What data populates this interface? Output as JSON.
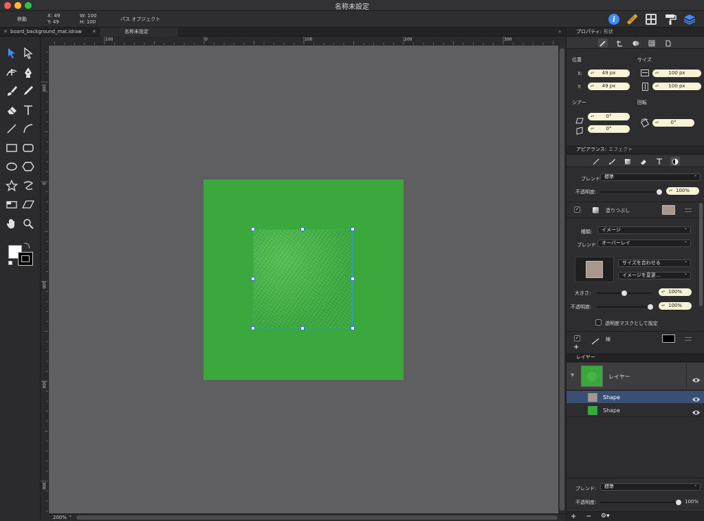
{
  "window": {
    "title": "名称未設定"
  },
  "toolbar": {
    "move_label": "移動",
    "x": "X:  49",
    "y": "Y:  49",
    "w": "W:  100",
    "h": "H:  100",
    "object_type": "パス オブジェクト"
  },
  "tabs": [
    {
      "label": "board_background_mat.idraw"
    },
    {
      "label": "名称未設定"
    }
  ],
  "ruler": {
    "top": [
      "100",
      "0",
      "100",
      "200",
      "300"
    ],
    "left": [
      "100",
      "0",
      "100",
      "200",
      "300"
    ]
  },
  "status": {
    "zoom": "200%"
  },
  "properties": {
    "header": "プロパティ:",
    "header_sub": "形状",
    "position_label": "位置",
    "size_label": "サイズ",
    "x_label": "X:",
    "y_label": "Y:",
    "x_value": "49 px",
    "y_value": "49 px",
    "w_value": "100 px",
    "h_value": "100 px",
    "shear_label": "シアー",
    "rotate_label": "回転",
    "shear_h": "0°",
    "shear_v": "0°",
    "rotate_value": "0°"
  },
  "appearance": {
    "header": "アピアランス:",
    "header_sub": "エフェクト",
    "blend_label": "ブレンド",
    "blend_value": "標準",
    "opacity_label": "不透明度:",
    "opacity_value": "100%",
    "opacity_level": 1.0,
    "fill_label": "塗りつぶし",
    "kind_label": "種類:",
    "kind_value": "イメージ",
    "fill_blend_label": "ブレンド",
    "fill_blend_value": "オーバーレイ",
    "fit_size": "サイズを合わせる",
    "change_image": "イメージを変更...",
    "scale_label": "大きさ:",
    "scale_value": "100%",
    "fill_opacity_label": "不透明度:",
    "fill_opacity_value": "100%",
    "mask_label": "透明度マスクとして設定",
    "stroke_label": "線",
    "add": "+"
  },
  "layers": {
    "header": "レイヤー",
    "layer_name": "レイヤー",
    "items": [
      {
        "label": "Shape",
        "selected": true
      },
      {
        "label": "Shape",
        "selected": false
      }
    ],
    "blend_label": "ブレンド:",
    "blend_value": "標準",
    "opacity_label": "不透明度:",
    "opacity_value": "100%",
    "opacity_level": 1.0,
    "add": "+",
    "remove": "−",
    "gear": "⚙"
  },
  "colors": {
    "accent_blue": "#3d8bfd",
    "green": "#3aa83d",
    "selection": "#3a4f74"
  }
}
